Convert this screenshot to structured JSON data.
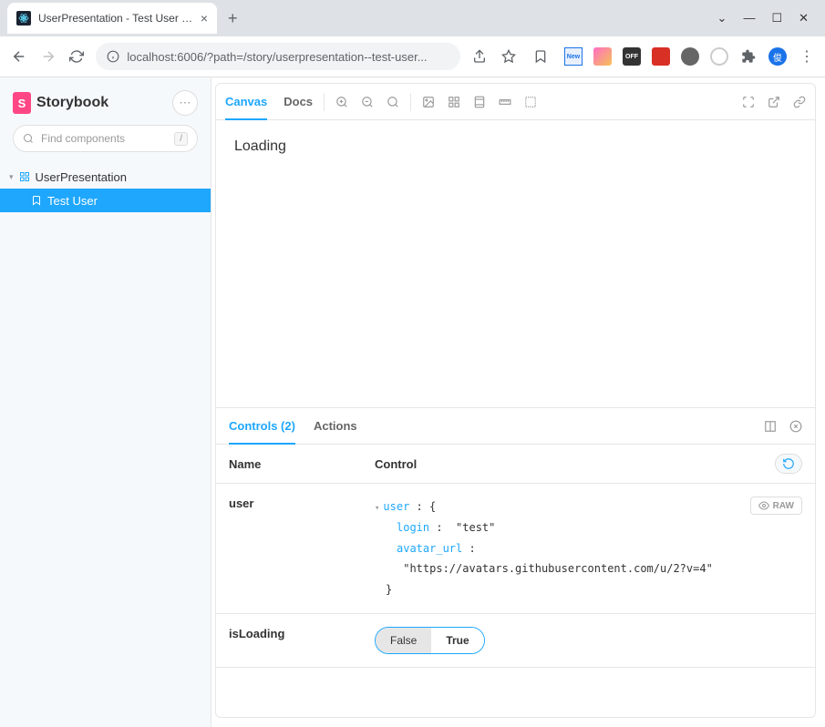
{
  "browser": {
    "tab_title": "UserPresentation - Test User · Sto",
    "url": "localhost:6006/?path=/story/userpresentation--test-user...",
    "ext_new": "New",
    "ext_off": "OFF",
    "avatar": "俊"
  },
  "sidebar": {
    "brand": "Storybook",
    "search_placeholder": "Find components",
    "search_shortcut": "/",
    "tree": {
      "component": "UserPresentation",
      "story": "Test User"
    }
  },
  "toolbar": {
    "canvas": "Canvas",
    "docs": "Docs"
  },
  "canvas": {
    "content": "Loading"
  },
  "addons": {
    "controls_label": "Controls (2)",
    "actions_label": "Actions",
    "col_name": "Name",
    "col_control": "Control",
    "raw_label": "RAW",
    "user_row": {
      "name": "user",
      "root_key": "user",
      "login_key": "login",
      "login_val": "\"test\"",
      "avatar_key": "avatar_url",
      "avatar_val": "\"https://avatars.githubusercontent.com/u/2?v=4\""
    },
    "loading_row": {
      "name": "isLoading",
      "false_label": "False",
      "true_label": "True"
    }
  }
}
